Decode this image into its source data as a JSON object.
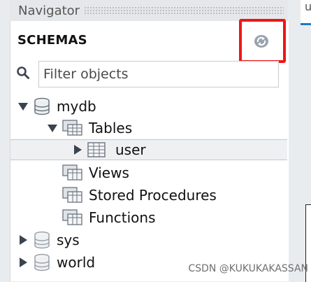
{
  "navigator": {
    "title": "Navigator"
  },
  "schemas": {
    "label": "SCHEMAS"
  },
  "refresh": {
    "icon": "refresh-icon",
    "highlight_color": "#ef1616"
  },
  "filter": {
    "placeholder": "Filter objects",
    "value": ""
  },
  "tree": {
    "mydb": {
      "label": "mydb",
      "expanded": true
    },
    "tables": {
      "label": "Tables",
      "expanded": true
    },
    "user": {
      "label": "user",
      "selected": true
    },
    "views": {
      "label": "Views"
    },
    "stored_procedures": {
      "label": "Stored Procedures"
    },
    "functions": {
      "label": "Functions"
    },
    "sys": {
      "label": "sys",
      "expanded": false
    },
    "world": {
      "label": "world",
      "expanded": false
    }
  },
  "right_tab": {
    "label": "u"
  },
  "watermark": "CSDN @KUKUKAKASSAN"
}
